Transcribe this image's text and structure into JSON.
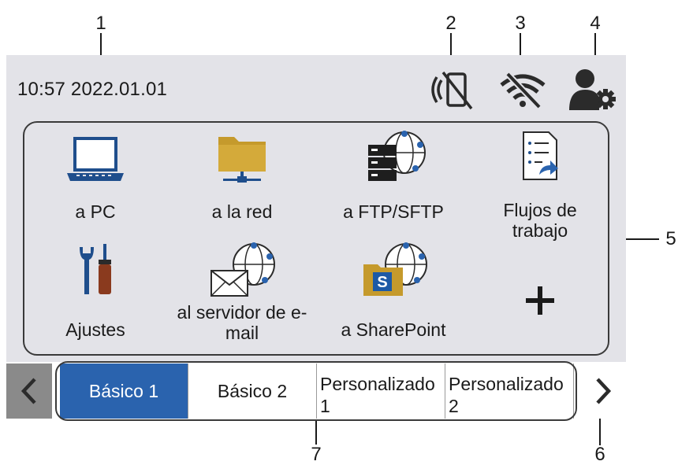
{
  "callouts": [
    "1",
    "2",
    "3",
    "4",
    "5",
    "6",
    "7"
  ],
  "status": {
    "datetime": "10:57 2022.01.01"
  },
  "icons": {
    "nfc": "nfc-off-icon",
    "wifi": "wifi-off-icon",
    "settings": "user-settings-icon"
  },
  "shortcuts": [
    {
      "label": "a PC",
      "icon": "laptop-icon"
    },
    {
      "label": "a la red",
      "icon": "network-folder-icon"
    },
    {
      "label": "a FTP/SFTP",
      "icon": "ftp-server-icon"
    },
    {
      "label": "Flujos de trabajo",
      "icon": "workflow-icon"
    },
    {
      "label": "Ajustes",
      "icon": "tools-icon"
    },
    {
      "label": "al servidor de e-mail",
      "icon": "email-server-icon"
    },
    {
      "label": "a SharePoint",
      "icon": "sharepoint-icon"
    },
    {
      "label": "",
      "icon": "plus-icon"
    }
  ],
  "tabs": [
    {
      "label": "Básico 1",
      "active": true
    },
    {
      "label": "Básico 2",
      "active": false
    },
    {
      "label": "Personalizado 1",
      "active": false
    },
    {
      "label": "Personalizado 2",
      "active": false
    }
  ],
  "colors": {
    "screen_bg": "#e3e3e8",
    "active_tab": "#2a63ae",
    "laptop_blue": "#1f4e8c",
    "folder_gold": "#c59a2c",
    "sharepoint_blue": "#1d5aa6"
  }
}
